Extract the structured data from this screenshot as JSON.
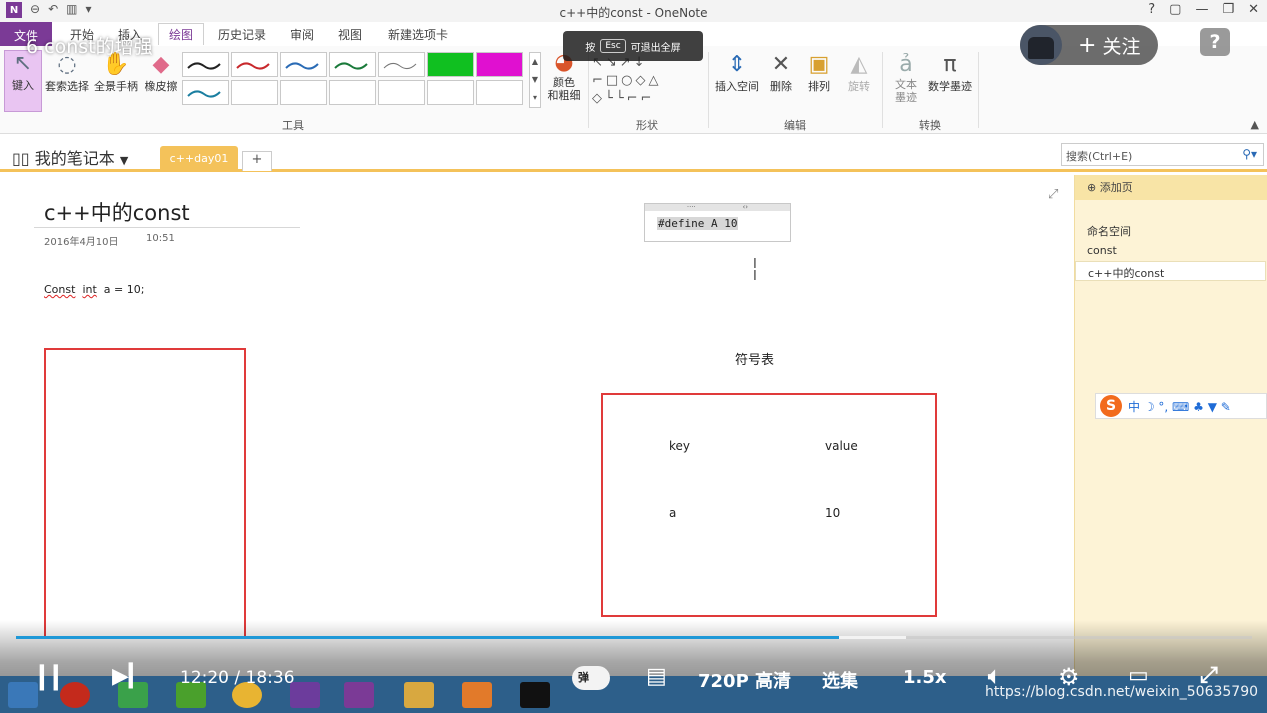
{
  "window": {
    "title": "c++中的const - OneNote",
    "controls": [
      "?",
      "▢",
      "—",
      "❐",
      "✕"
    ]
  },
  "menu_tabs": [
    "文件",
    "开始",
    "插入",
    "绘图",
    "历史记录",
    "审阅",
    "视图",
    "新建选项卡"
  ],
  "ribbon": {
    "tools": [
      "键入",
      "套索选择",
      "全景手柄",
      "橡皮擦"
    ],
    "color_thickness": "颜色\n和粗细",
    "edit_buttons": [
      "插入空间",
      "删除",
      "排列",
      "旋转"
    ],
    "convert_buttons": [
      "文本\n墨迹",
      "数学墨迹"
    ],
    "groups": [
      "工具",
      "形状",
      "编辑",
      "转换"
    ],
    "pen_colors": [
      "#222222",
      "#c8282c",
      "#2a6bb5",
      "#1a7a3a",
      "#777777",
      "#10c020",
      "#e010d0",
      "#1a7ea0"
    ]
  },
  "notebook": {
    "name": "我的笔记本",
    "section_tab": "c++day01",
    "add_section": "+",
    "search_placeholder": "搜索(Ctrl+E)"
  },
  "page": {
    "title": "c++中的const",
    "date": "2016年4月10日",
    "time": "10:51",
    "code_word1": "Const",
    "code_word2": "int",
    "code_rest": "a = 10;",
    "define_text": "#define A 10",
    "cursor": "I",
    "symbol_table_label": "符号表",
    "table": {
      "header_key": "key",
      "header_value": "value",
      "row_key": "a",
      "row_value": "10"
    }
  },
  "page_list": {
    "add_page": "添加页",
    "items": [
      "命名空间",
      "const",
      "c++中的const"
    ]
  },
  "ime": {
    "logo": "S",
    "items": "中 ☽ °, ⌨ ♣ ▼ ✎"
  },
  "player": {
    "video_title": "6 const的增强",
    "esc_prefix": "按",
    "esc_key": "Esc",
    "esc_suffix": "可退出全屏",
    "follow": "关注",
    "help": "?",
    "current_time": "12:20",
    "duration": "18:36",
    "time_separator": "/",
    "danmaku": "弹",
    "quality": "720P 高清",
    "episodes": "选集",
    "speed": "1.5x",
    "progress": 0.666,
    "buffered": 0.72,
    "watermark": "https://blog.csdn.net/weixin_50635790"
  }
}
